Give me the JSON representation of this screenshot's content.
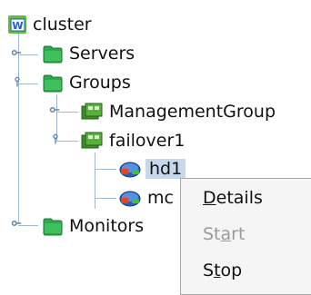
{
  "tree": {
    "root": "cluster",
    "servers": "Servers",
    "groups": "Groups",
    "management_group": "ManagementGroup",
    "failover1": "failover1",
    "hd1": "hd1",
    "md_partial": "mc",
    "monitors": "Monitors"
  },
  "context_menu": {
    "details": {
      "pre": "",
      "u": "D",
      "post": "etails"
    },
    "start": {
      "pre": "St",
      "u": "a",
      "post": "rt",
      "enabled": false
    },
    "stop": {
      "pre": "S",
      "u": "t",
      "post": "op"
    }
  },
  "icons": [
    "cluster-icon",
    "folder-icon",
    "group-icon",
    "resource-icon",
    "toggle-collapsed-icon",
    "toggle-expanded-icon"
  ],
  "colors": {
    "selection": "#c8d8ec",
    "folder": "#2ea84a",
    "group": "#3c8f2a",
    "disk": "#2b5fb8"
  }
}
